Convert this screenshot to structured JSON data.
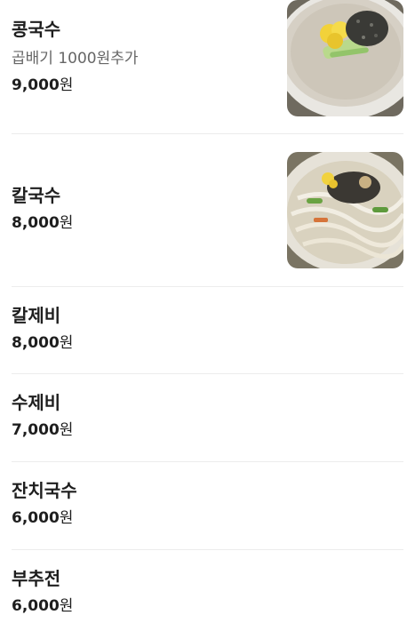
{
  "menu": {
    "currency_unit": "원",
    "items": [
      {
        "name": "콩국수",
        "description": "곱배기 1000원추가",
        "price": "9,000",
        "image": "bean-noodle-photo"
      },
      {
        "name": "칼국수",
        "price": "8,000",
        "image": "kalguksu-photo"
      },
      {
        "name": "칼제비",
        "price": "8,000"
      },
      {
        "name": "수제비",
        "price": "7,000"
      },
      {
        "name": "잔치국수",
        "price": "6,000"
      },
      {
        "name": "부추전",
        "price": "6,000"
      }
    ]
  }
}
